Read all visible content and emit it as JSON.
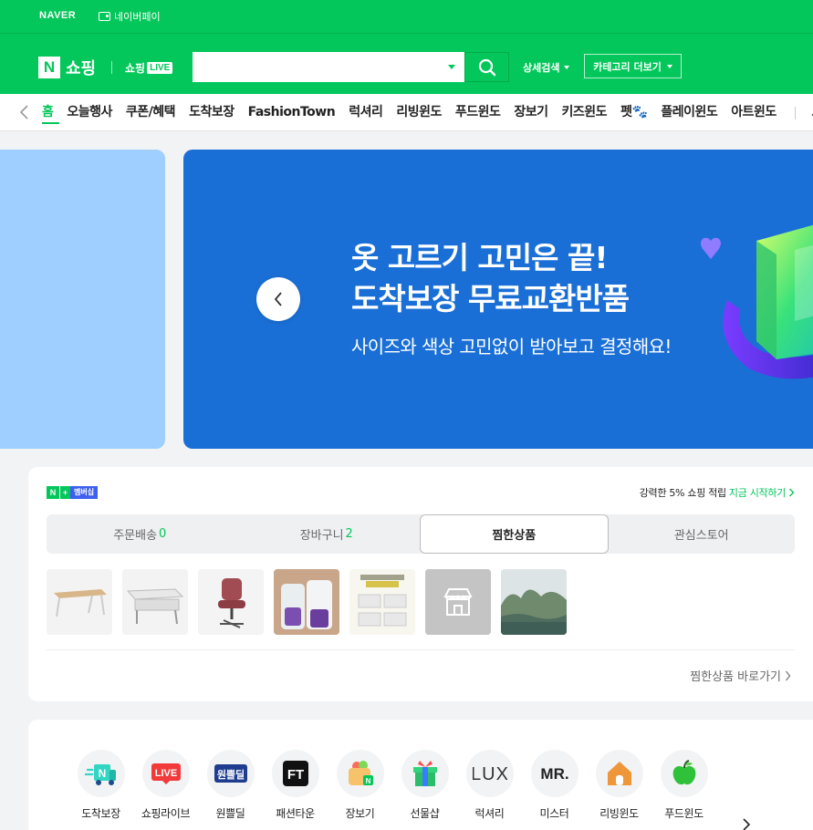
{
  "topbar": {
    "naver_logo": "NAVER",
    "pay_label": "네이버페이"
  },
  "header": {
    "logo_letter": "N",
    "shop_title": "쇼핑",
    "live_prefix": "쇼핑",
    "live_badge": "LIVE",
    "search_value": "",
    "search_placeholder": "",
    "detail_search": "상세검색",
    "category_more": "카테고리 더보기"
  },
  "catnav": {
    "items": [
      "홈",
      "오늘행사",
      "쿠폰/혜택",
      "도착보장",
      "FashionTown",
      "럭셔리",
      "리빙윈도",
      "푸드윈도",
      "장보기",
      "키즈윈도",
      "펫🐾",
      "플레이윈도",
      "아트윈도"
    ],
    "last_item": "도",
    "active_index": 0
  },
  "banner": {
    "title_line1": "옷 고르기 고민은 끝!",
    "title_line2": "도착보장 무료교환반품",
    "subtitle": "사이즈와 색상 고민없이 받아보고 결정해요!",
    "colors": {
      "main_bg": "#1a6fd6",
      "side_bg": "#9ecfff"
    }
  },
  "membership": {
    "badge_n": "N",
    "badge_plus": "+",
    "badge_text": "멤버십",
    "promo_text": "강력한 5% 쇼핑 적립",
    "promo_link": "지금 시작하기",
    "tabs": [
      {
        "label": "주문배송",
        "count": "0"
      },
      {
        "label": "장바구니",
        "count": "2"
      },
      {
        "label": "찜한상품",
        "count": ""
      },
      {
        "label": "관심스토어",
        "count": ""
      }
    ],
    "active_tab": 2,
    "thumbnails": [
      "table-image",
      "folding-table-image",
      "office-chair-image",
      "food-pack-image",
      "promo-card-image",
      "store-placeholder-image",
      "landscape-image"
    ],
    "wish_link": "찜한상품 바로가기"
  },
  "services": {
    "items": [
      {
        "label": "도착보장",
        "icon": "delivery-truck-icon"
      },
      {
        "label": "쇼핑라이브",
        "icon": "live-icon"
      },
      {
        "label": "원쁠딜",
        "icon": "oneplus-deal-icon"
      },
      {
        "label": "패션타운",
        "icon": "fashiontown-icon"
      },
      {
        "label": "장보기",
        "icon": "grocery-bag-icon"
      },
      {
        "label": "선물샵",
        "icon": "gift-icon"
      },
      {
        "label": "럭셔리",
        "icon": "luxury-icon"
      },
      {
        "label": "미스터",
        "icon": "mister-icon"
      },
      {
        "label": "리빙윈도",
        "icon": "house-icon"
      },
      {
        "label": "푸드윈도",
        "icon": "apple-icon"
      }
    ],
    "icon_texts": {
      "live": "LIVE",
      "oneplus": "원쁠딜",
      "ft": "FT",
      "lux": "LUX",
      "mr": "MR."
    }
  },
  "colors": {
    "brand": "#03c75a",
    "accent_blue": "#3d5ef0"
  }
}
